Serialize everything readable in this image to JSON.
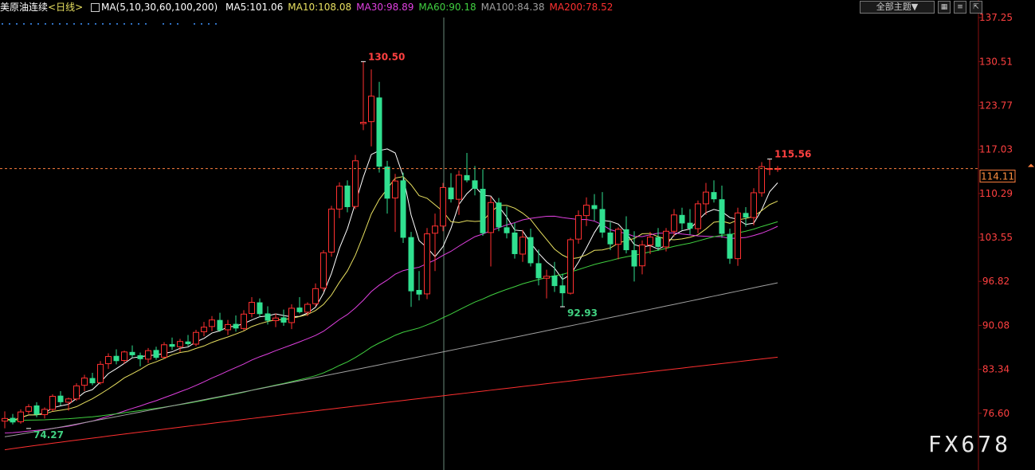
{
  "header": {
    "symbol": "美原油连续",
    "period": "<日线>",
    "ma_params": "MA(5,10,30,60,100,200)",
    "ma_values": [
      {
        "label": "MA5:101.06",
        "color": "#ffffff"
      },
      {
        "label": "MA10:108.08",
        "color": "#e8e060"
      },
      {
        "label": "MA30:98.89",
        "color": "#e040e0"
      },
      {
        "label": "MA60:90.18",
        "color": "#40d040"
      },
      {
        "label": "MA100:84.38",
        "color": "#a0a0a0"
      },
      {
        "label": "MA200:78.52",
        "color": "#ff3030"
      }
    ]
  },
  "controls": {
    "theme_button": "全部主题▼",
    "mini_icons": [
      "grid-icon",
      "list-icon",
      "expand-icon"
    ]
  },
  "watermark": "FX678",
  "colors": {
    "up": "#ff3030",
    "down": "#30e090",
    "axis_text": "#ff4040",
    "grid_dots": "#3070c0"
  },
  "chart_data": {
    "type": "candlestick",
    "ylim": [
      74.5,
      137.5
    ],
    "yticks": [
      137.25,
      130.51,
      123.77,
      117.03,
      110.29,
      103.55,
      96.82,
      90.08,
      83.34,
      76.6
    ],
    "current_price": 114.11,
    "annotations": [
      {
        "text": "130.50",
        "value": 130.5,
        "kind": "high"
      },
      {
        "text": "92.93",
        "value": 92.93,
        "kind": "low"
      },
      {
        "text": "115.56",
        "value": 115.56,
        "kind": "high"
      },
      {
        "text": "74.27",
        "value": 74.27,
        "kind": "low"
      }
    ],
    "candles": [
      [
        75.4,
        76.9,
        74.3,
        75.8
      ],
      [
        75.9,
        76.5,
        74.9,
        75.2
      ],
      [
        75.3,
        77.2,
        75.0,
        76.8
      ],
      [
        76.9,
        78.0,
        76.5,
        77.6
      ],
      [
        77.8,
        78.3,
        76.0,
        76.4
      ],
      [
        76.4,
        77.5,
        75.8,
        77.2
      ],
      [
        77.2,
        79.5,
        76.9,
        79.2
      ],
      [
        79.3,
        80.0,
        77.8,
        78.3
      ],
      [
        78.3,
        79.0,
        77.0,
        78.8
      ],
      [
        78.8,
        81.2,
        78.5,
        80.8
      ],
      [
        80.9,
        82.5,
        80.0,
        82.0
      ],
      [
        82.0,
        82.8,
        80.9,
        81.2
      ],
      [
        81.3,
        84.6,
        81.0,
        84.1
      ],
      [
        84.2,
        85.8,
        83.4,
        85.3
      ],
      [
        85.4,
        86.4,
        84.1,
        84.6
      ],
      [
        84.7,
        86.2,
        84.2,
        86.0
      ],
      [
        86.0,
        87.0,
        85.1,
        85.5
      ],
      [
        85.5,
        85.9,
        83.8,
        84.9
      ],
      [
        84.9,
        86.6,
        84.3,
        86.2
      ],
      [
        86.3,
        86.8,
        84.8,
        85.1
      ],
      [
        85.2,
        87.5,
        85.0,
        87.1
      ],
      [
        87.2,
        88.2,
        86.3,
        86.8
      ],
      [
        86.8,
        88.0,
        86.0,
        87.6
      ],
      [
        87.6,
        88.6,
        86.9,
        87.2
      ],
      [
        87.2,
        89.4,
        86.9,
        89.0
      ],
      [
        89.1,
        90.6,
        88.4,
        89.8
      ],
      [
        89.9,
        91.5,
        89.2,
        90.9
      ],
      [
        90.9,
        92.0,
        89.1,
        89.3
      ],
      [
        89.4,
        90.9,
        88.6,
        90.2
      ],
      [
        90.3,
        91.6,
        89.1,
        89.6
      ],
      [
        89.6,
        92.4,
        89.3,
        91.8
      ],
      [
        91.9,
        94.4,
        91.3,
        93.6
      ],
      [
        93.6,
        94.2,
        91.3,
        91.8
      ],
      [
        91.9,
        93.0,
        90.2,
        90.8
      ],
      [
        90.8,
        91.9,
        89.8,
        91.2
      ],
      [
        91.3,
        92.5,
        90.0,
        90.5
      ],
      [
        90.5,
        93.3,
        89.5,
        92.7
      ],
      [
        92.8,
        94.4,
        91.9,
        92.1
      ],
      [
        92.1,
        93.6,
        91.5,
        93.3
      ],
      [
        93.4,
        96.5,
        93.0,
        95.7
      ],
      [
        95.8,
        101.6,
        95.3,
        101.2
      ],
      [
        101.3,
        108.4,
        100.6,
        107.9
      ],
      [
        107.9,
        112.0,
        106.5,
        111.4
      ],
      [
        111.5,
        112.3,
        107.4,
        108.2
      ],
      [
        108.3,
        116.2,
        107.9,
        115.3
      ],
      [
        121.0,
        130.5,
        120.0,
        121.2
      ],
      [
        121.3,
        129.3,
        117.5,
        125.2
      ],
      [
        125.0,
        127.4,
        113.5,
        114.4
      ],
      [
        114.4,
        115.3,
        107.2,
        109.5
      ],
      [
        109.6,
        113.3,
        104.4,
        112.2
      ],
      [
        112.3,
        113.5,
        102.7,
        103.5
      ],
      [
        103.6,
        104.4,
        92.9,
        95.3
      ],
      [
        95.5,
        98.4,
        93.9,
        94.8
      ],
      [
        94.9,
        105.0,
        94.1,
        104.1
      ],
      [
        104.2,
        107.2,
        98.4,
        105.3
      ],
      [
        105.3,
        111.9,
        104.5,
        111.2
      ],
      [
        111.2,
        113.4,
        108.9,
        109.4
      ],
      [
        109.4,
        113.8,
        107.0,
        113.1
      ],
      [
        113.1,
        116.5,
        112.0,
        112.3
      ],
      [
        112.3,
        114.5,
        110.0,
        111.0
      ],
      [
        111.0,
        114.0,
        103.8,
        104.2
      ],
      [
        104.3,
        109.8,
        99.1,
        108.9
      ],
      [
        108.9,
        109.6,
        104.5,
        105.1
      ],
      [
        105.1,
        108.3,
        103.4,
        104.2
      ],
      [
        104.3,
        105.8,
        100.3,
        101.0
      ],
      [
        101.0,
        104.7,
        99.8,
        103.6
      ],
      [
        103.6,
        104.9,
        99.1,
        99.6
      ],
      [
        99.6,
        101.7,
        96.2,
        97.3
      ],
      [
        97.3,
        98.6,
        94.2,
        97.6
      ],
      [
        97.7,
        99.8,
        95.2,
        96.1
      ],
      [
        96.2,
        98.0,
        92.9,
        95.0
      ],
      [
        95.0,
        103.5,
        94.8,
        103.2
      ],
      [
        103.3,
        107.7,
        102.6,
        106.9
      ],
      [
        106.9,
        109.7,
        105.3,
        108.5
      ],
      [
        108.5,
        110.2,
        106.1,
        107.9
      ],
      [
        107.9,
        110.5,
        103.5,
        104.3
      ],
      [
        104.3,
        105.9,
        101.6,
        102.5
      ],
      [
        102.5,
        105.1,
        100.2,
        104.8
      ],
      [
        104.8,
        106.8,
        101.1,
        101.6
      ],
      [
        101.6,
        104.5,
        96.8,
        99.1
      ],
      [
        99.2,
        103.1,
        97.9,
        102.4
      ],
      [
        102.4,
        104.4,
        101.0,
        103.6
      ],
      [
        103.6,
        105.0,
        101.5,
        102.1
      ],
      [
        102.1,
        105.0,
        101.4,
        104.5
      ],
      [
        104.5,
        107.9,
        103.7,
        107.0
      ],
      [
        107.0,
        108.1,
        104.7,
        105.7
      ],
      [
        105.8,
        107.9,
        104.0,
        104.9
      ],
      [
        104.9,
        109.2,
        104.2,
        108.7
      ],
      [
        108.7,
        111.9,
        107.0,
        110.5
      ],
      [
        110.5,
        112.3,
        108.9,
        109.4
      ],
      [
        109.4,
        111.5,
        103.5,
        104.1
      ],
      [
        104.1,
        104.9,
        99.5,
        100.3
      ],
      [
        100.3,
        108.1,
        99.2,
        107.3
      ],
      [
        107.3,
        108.2,
        105.2,
        106.6
      ],
      [
        106.6,
        111.1,
        105.4,
        110.4
      ],
      [
        110.4,
        115.1,
        109.8,
        114.4
      ],
      [
        114.0,
        115.56,
        113.1,
        114.1
      ],
      [
        114.1,
        114.5,
        113.6,
        114.1
      ]
    ]
  }
}
